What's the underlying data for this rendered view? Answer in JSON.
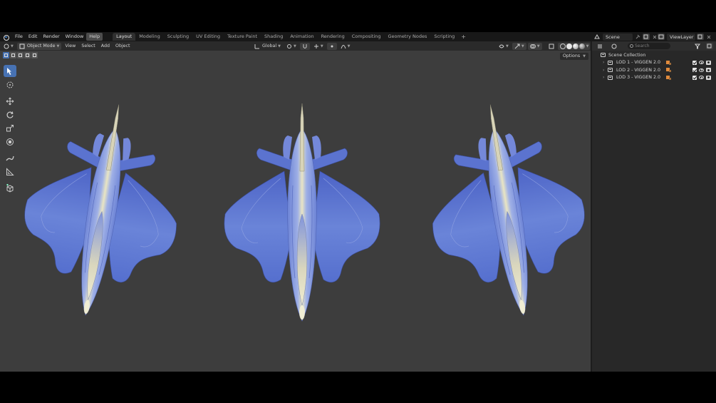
{
  "menu": {
    "items": [
      "File",
      "Edit",
      "Render",
      "Window",
      "Help"
    ],
    "active_index": 4
  },
  "workspaces": {
    "tabs": [
      "Layout",
      "Modeling",
      "Sculpting",
      "UV Editing",
      "Texture Paint",
      "Shading",
      "Animation",
      "Rendering",
      "Compositing",
      "Geometry Nodes",
      "Scripting"
    ],
    "active_index": 0,
    "add_label": "+"
  },
  "scene": {
    "name": "Scene"
  },
  "view_layer": {
    "name": "ViewLayer"
  },
  "viewport_header": {
    "mode": "Object Mode",
    "menus": [
      "View",
      "Select",
      "Add",
      "Object"
    ],
    "transform_orientation": "Global",
    "options_label": "Options"
  },
  "toolbar": {
    "tools": [
      {
        "name": "select-box-tool",
        "icon": "cursor-box-icon",
        "active": true
      },
      {
        "name": "cursor-tool",
        "icon": "3d-cursor-icon",
        "active": false
      },
      {
        "name": "move-tool",
        "icon": "move-icon",
        "active": false
      },
      {
        "name": "rotate-tool",
        "icon": "rotate-icon",
        "active": false
      },
      {
        "name": "scale-tool",
        "icon": "scale-icon",
        "active": false
      },
      {
        "name": "transform-tool",
        "icon": "transform-icon",
        "active": false
      },
      {
        "name": "annotate-tool",
        "icon": "annotate-icon",
        "active": false
      },
      {
        "name": "measure-tool",
        "icon": "measure-icon",
        "active": false
      },
      {
        "name": "add-cube-tool",
        "icon": "add-cube-icon",
        "active": false
      }
    ]
  },
  "outliner": {
    "search_placeholder": "Search",
    "root": "Scene Collection",
    "collections": [
      {
        "label": "LOD 1 - VIGGEN 2.0"
      },
      {
        "label": "LOD 2 - VIGGEN 2.0"
      },
      {
        "label": "LOD 3 - VIGGEN 2.0"
      }
    ]
  },
  "colors": {
    "accent": "#4772b3",
    "viewport_bg": "#3d3d3d",
    "aircraft_blue": "#5f79cf",
    "aircraft_cream": "#e7e2bf"
  }
}
